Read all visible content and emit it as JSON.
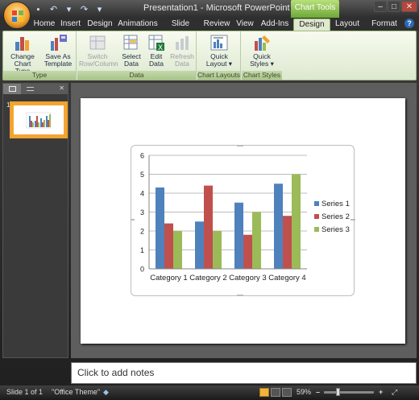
{
  "window": {
    "title": "Presentation1 - Microsoft PowerPoint",
    "contextual_tab_group": "Chart Tools",
    "controls": {
      "minimize": "–",
      "maximize": "□",
      "close": "✕"
    }
  },
  "quick_access": [
    {
      "name": "save-icon",
      "glyph": "▪"
    },
    {
      "name": "undo-icon",
      "glyph": "↶"
    },
    {
      "name": "undo-dropdown-icon",
      "glyph": "▾"
    },
    {
      "name": "redo-icon",
      "glyph": "↷"
    },
    {
      "name": "qat-customize-icon",
      "glyph": "▾"
    }
  ],
  "tabs": [
    "Home",
    "Insert",
    "Design",
    "Animations",
    "Slide Show",
    "Review",
    "View",
    "Add-Ins",
    "Design",
    "Layout",
    "Format"
  ],
  "active_tab_index": 8,
  "ribbon": {
    "groups": {
      "type": "Type",
      "data": "Data",
      "chart_layouts": "Chart Layouts",
      "chart_styles": "Chart Styles"
    },
    "buttons": {
      "change_chart_type": [
        "Change",
        "Chart Type"
      ],
      "save_as_template": [
        "Save As",
        "Template"
      ],
      "switch_row_column": [
        "Switch",
        "Row/Column"
      ],
      "select_data": [
        "Select",
        "Data"
      ],
      "edit_data": [
        "Edit",
        "Data"
      ],
      "refresh_data": [
        "Refresh",
        "Data"
      ],
      "quick_layout": [
        "Quick",
        "Layout ▾"
      ],
      "quick_styles": [
        "Quick",
        "Styles ▾"
      ]
    }
  },
  "slides_pane": {
    "tabs": [
      "",
      "",
      "✕"
    ],
    "slide_number": "1"
  },
  "notes_placeholder": "Click to add notes",
  "status": {
    "slide": "Slide 1 of 1",
    "theme": "\"Office Theme\"",
    "zoom": "59%",
    "zoom_out": "–",
    "zoom_in": "+"
  },
  "colors": {
    "series1": "#4f81bd",
    "series2": "#c0504d",
    "series3": "#9bbb59",
    "active_tab": "#dfe8d0",
    "chart_tools": "#7fb247"
  },
  "chart_data": {
    "type": "bar",
    "categories": [
      "Category 1",
      "Category 2",
      "Category 3",
      "Category 4"
    ],
    "series": [
      {
        "name": "Series 1",
        "values": [
          4.3,
          2.5,
          3.5,
          4.5
        ]
      },
      {
        "name": "Series 2",
        "values": [
          2.4,
          4.4,
          1.8,
          2.8
        ]
      },
      {
        "name": "Series 3",
        "values": [
          2,
          2,
          3,
          5
        ]
      }
    ],
    "yticks": [
      "0",
      "1",
      "2",
      "3",
      "4",
      "5",
      "6"
    ],
    "ylim": [
      0,
      6
    ],
    "grid": true,
    "legend": "right"
  }
}
